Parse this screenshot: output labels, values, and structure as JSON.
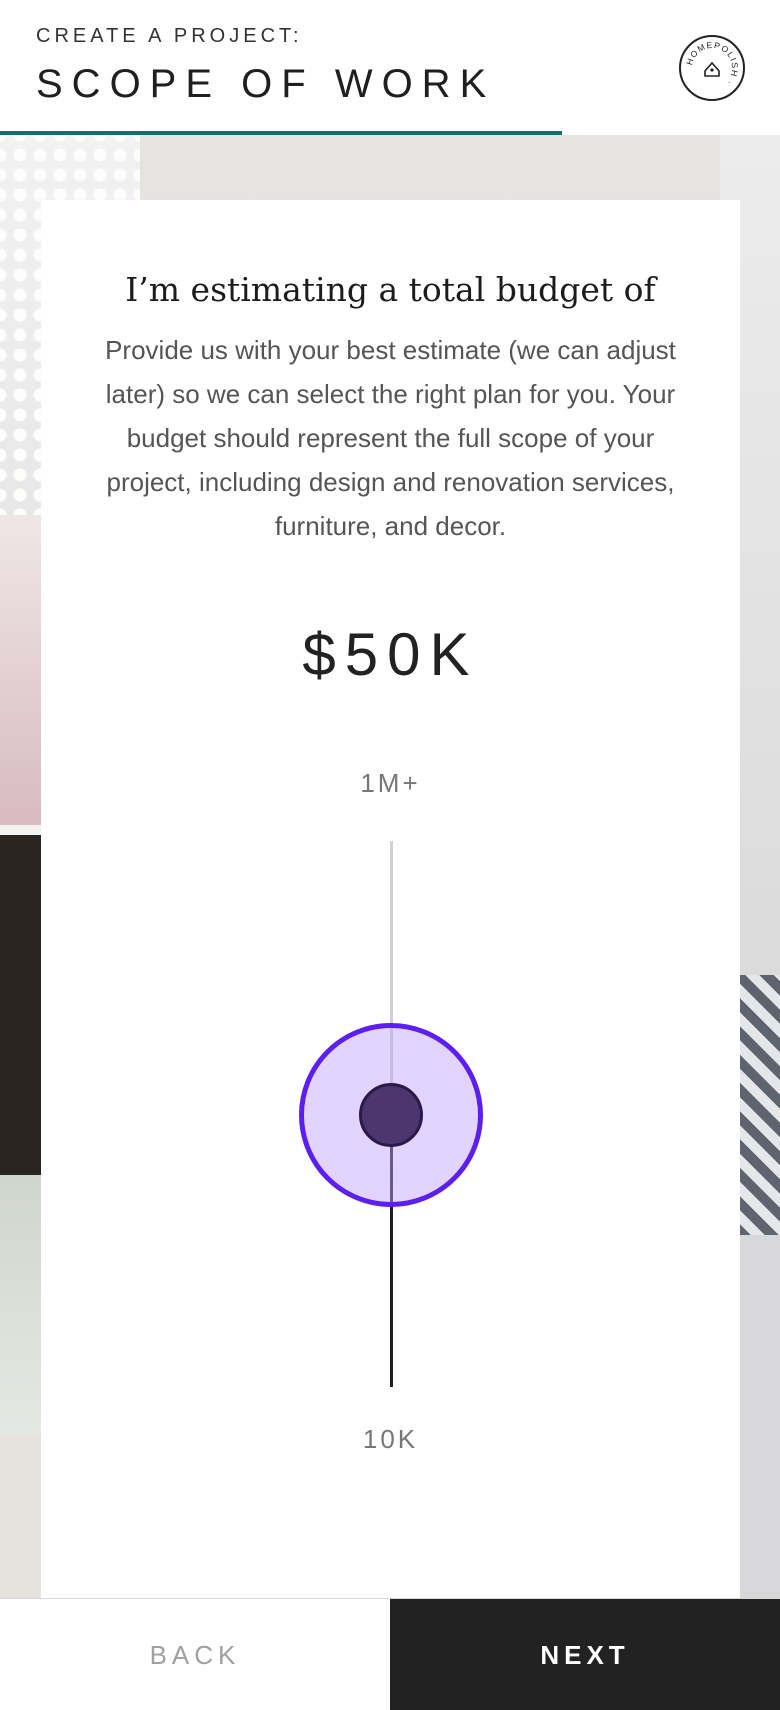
{
  "header": {
    "eyebrow": "CREATE A PROJECT:",
    "title": "SCOPE OF WORK",
    "logo_text": "HOMEPOLISH",
    "progress": 0.72,
    "accent_color": "#1f6b6b"
  },
  "card": {
    "heading": "I’m estimating a total budget of",
    "description": "Provide us with your best estimate (we can adjust later) so we can select the right plan for you. Your budget should represent the full scope of your project, including design and renovation services, furniture, and decor.",
    "amount": "$50K"
  },
  "slider": {
    "max_label": "1M+",
    "min_label": "10K",
    "value": "$50K",
    "thumb_color": "#5b1ff0"
  },
  "footer": {
    "back_label": "BACK",
    "next_label": "NEXT"
  }
}
